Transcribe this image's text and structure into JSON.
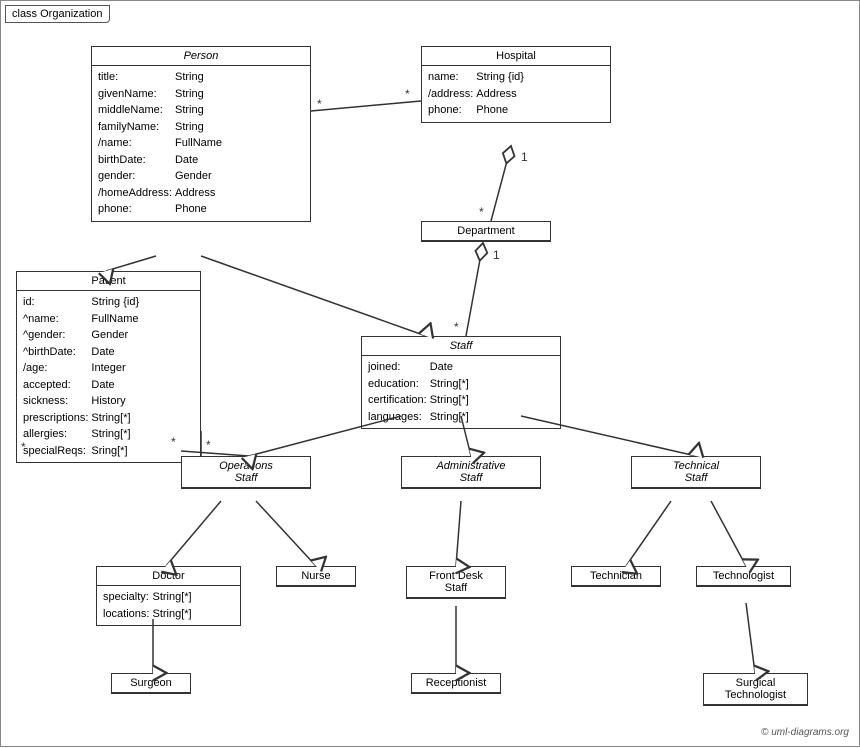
{
  "diagram": {
    "title": "class Organization",
    "copyright": "© uml-diagrams.org",
    "boxes": {
      "person": {
        "title": "Person",
        "fields": [
          [
            "title:",
            "String"
          ],
          [
            "givenName:",
            "String"
          ],
          [
            "middleName:",
            "String"
          ],
          [
            "familyName:",
            "String"
          ],
          [
            "/name:",
            "FullName"
          ],
          [
            "birthDate:",
            "Date"
          ],
          [
            "gender:",
            "Gender"
          ],
          [
            "/homeAddress:",
            "Address"
          ],
          [
            "phone:",
            "Phone"
          ]
        ]
      },
      "hospital": {
        "title": "Hospital",
        "fields": [
          [
            "name:",
            "String {id}"
          ],
          [
            "/address:",
            "Address"
          ],
          [
            "phone:",
            "Phone"
          ]
        ]
      },
      "patient": {
        "title": "Patient",
        "fields": [
          [
            "id:",
            "String {id}"
          ],
          [
            "^name:",
            "FullName"
          ],
          [
            "^gender:",
            "Gender"
          ],
          [
            "^birthDate:",
            "Date"
          ],
          [
            "/age:",
            "Integer"
          ],
          [
            "accepted:",
            "Date"
          ],
          [
            "sickness:",
            "History"
          ],
          [
            "prescriptions:",
            "String[*]"
          ],
          [
            "allergies:",
            "String[*]"
          ],
          [
            "specialReqs:",
            "Sring[*]"
          ]
        ]
      },
      "department": {
        "title": "Department"
      },
      "staff": {
        "title": "Staff",
        "fields": [
          [
            "joined:",
            "Date"
          ],
          [
            "education:",
            "String[*]"
          ],
          [
            "certification:",
            "String[*]"
          ],
          [
            "languages:",
            "String[*]"
          ]
        ]
      },
      "operations_staff": {
        "title": "Operations Staff"
      },
      "administrative_staff": {
        "title": "Administrative Staff"
      },
      "technical_staff": {
        "title": "Technical Staff"
      },
      "doctor": {
        "title": "Doctor",
        "fields": [
          [
            "specialty:",
            "String[*]"
          ],
          [
            "locations:",
            "String[*]"
          ]
        ]
      },
      "nurse": {
        "title": "Nurse"
      },
      "front_desk_staff": {
        "title": "Front Desk Staff"
      },
      "technician": {
        "title": "Technician"
      },
      "technologist": {
        "title": "Technologist"
      },
      "surgeon": {
        "title": "Surgeon"
      },
      "receptionist": {
        "title": "Receptionist"
      },
      "surgical_technologist": {
        "title": "Surgical Technologist"
      }
    }
  }
}
